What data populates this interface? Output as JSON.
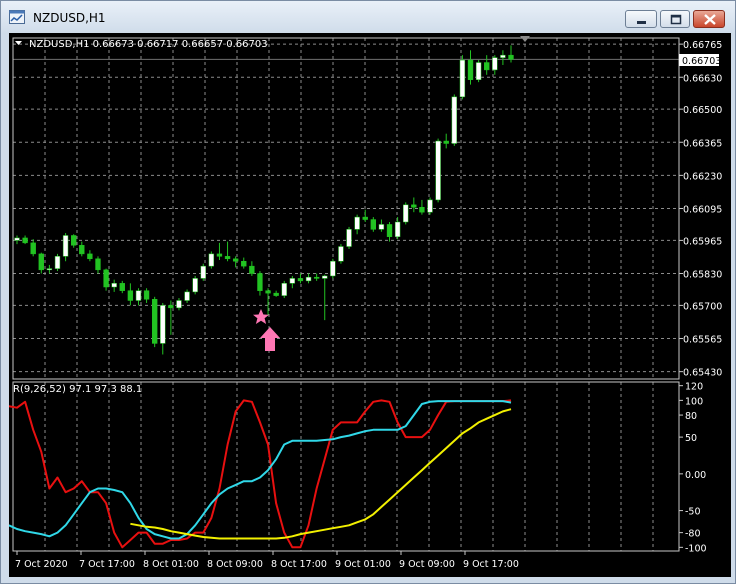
{
  "window": {
    "title": "NZDUSD,H1",
    "icons": {
      "app": "chart-window-icon",
      "minimize": "minimize-icon",
      "maximize": "maximize-icon",
      "close": "close-icon"
    }
  },
  "chart": {
    "header": "NZDUSD,H1  0.66673 0.66717 0.66657 0.66703",
    "current_price": "0.66703",
    "price_ticks": [
      "0.66765",
      "0.66630",
      "0.66500",
      "0.66365",
      "0.66230",
      "0.66095",
      "0.65965",
      "0.65830",
      "0.65700",
      "0.65565",
      "0.65430"
    ],
    "time_ticks": [
      "7 Oct 2020",
      "7 Oct 17:00",
      "8 Oct 01:00",
      "8 Oct 09:00",
      "8 Oct 17:00",
      "9 Oct 01:00",
      "9 Oct 09:00",
      "9 Oct 17:00"
    ],
    "indicator_header": "R(9,26,52) 97.1 97.3 88.1",
    "indicator_ticks": [
      "120",
      "100",
      "80",
      "50",
      "0.00",
      "-50",
      "-80",
      "-100"
    ],
    "colors": {
      "bull": "#ffffff",
      "bear": "#22c322",
      "wick": "#22c322",
      "grid": "#8c8c8c",
      "fast": "#e81010",
      "mid": "#30d8e8",
      "slow": "#f2f000",
      "marker": "#ff77b4"
    },
    "markers": {
      "star": "star-icon",
      "arrow": "up-arrow-icon"
    }
  },
  "chart_data": [
    {
      "type": "candlestick",
      "title": "NZDUSD,H1",
      "ylim": [
        0.654,
        0.6679
      ],
      "candles": [
        [
          0.65965,
          0.65985,
          0.6595,
          0.65975
        ],
        [
          0.65975,
          0.65985,
          0.6595,
          0.65955
        ],
        [
          0.65955,
          0.6597,
          0.659,
          0.6591
        ],
        [
          0.6591,
          0.65915,
          0.6583,
          0.65845
        ],
        [
          0.65845,
          0.65865,
          0.6583,
          0.6585
        ],
        [
          0.6585,
          0.6591,
          0.6584,
          0.659
        ],
        [
          0.659,
          0.65995,
          0.6588,
          0.65985
        ],
        [
          0.65985,
          0.6599,
          0.65935,
          0.65945
        ],
        [
          0.65945,
          0.6596,
          0.659,
          0.6591
        ],
        [
          0.6591,
          0.65925,
          0.6588,
          0.6589
        ],
        [
          0.6589,
          0.659,
          0.6583,
          0.65845
        ],
        [
          0.65845,
          0.6585,
          0.6576,
          0.65775
        ],
        [
          0.65775,
          0.65805,
          0.65755,
          0.6579
        ],
        [
          0.6579,
          0.658,
          0.6575,
          0.6576
        ],
        [
          0.6576,
          0.6579,
          0.657,
          0.6572
        ],
        [
          0.6572,
          0.6577,
          0.657,
          0.6576
        ],
        [
          0.6576,
          0.6577,
          0.6571,
          0.65725
        ],
        [
          0.65725,
          0.65735,
          0.6553,
          0.65545
        ],
        [
          0.65545,
          0.6571,
          0.655,
          0.657
        ],
        [
          0.657,
          0.6572,
          0.6558,
          0.6569
        ],
        [
          0.6569,
          0.6573,
          0.6568,
          0.6572
        ],
        [
          0.6572,
          0.65765,
          0.6571,
          0.65755
        ],
        [
          0.65755,
          0.6582,
          0.65745,
          0.6581
        ],
        [
          0.6581,
          0.6587,
          0.658,
          0.6586
        ],
        [
          0.6586,
          0.6592,
          0.6585,
          0.6591
        ],
        [
          0.6591,
          0.65955,
          0.65885,
          0.659
        ],
        [
          0.659,
          0.6596,
          0.6588,
          0.6589
        ],
        [
          0.6589,
          0.659,
          0.65855,
          0.6588
        ],
        [
          0.6588,
          0.65895,
          0.6585,
          0.6586
        ],
        [
          0.6586,
          0.6588,
          0.6582,
          0.6583
        ],
        [
          0.6583,
          0.6584,
          0.6574,
          0.6576
        ],
        [
          0.6576,
          0.6577,
          0.6566,
          0.6575
        ],
        [
          0.6575,
          0.6576,
          0.65735,
          0.6574
        ],
        [
          0.6574,
          0.658,
          0.6573,
          0.6579
        ],
        [
          0.6579,
          0.6582,
          0.6577,
          0.6581
        ],
        [
          0.6581,
          0.6583,
          0.6579,
          0.658
        ],
        [
          0.658,
          0.6583,
          0.6579,
          0.65815
        ],
        [
          0.65815,
          0.6583,
          0.658,
          0.6581
        ],
        [
          0.6581,
          0.65825,
          0.6564,
          0.6582
        ],
        [
          0.6582,
          0.6589,
          0.6581,
          0.6588
        ],
        [
          0.6588,
          0.6595,
          0.6587,
          0.6594
        ],
        [
          0.6594,
          0.6602,
          0.6593,
          0.6601
        ],
        [
          0.6601,
          0.6607,
          0.6599,
          0.6606
        ],
        [
          0.6606,
          0.6609,
          0.6604,
          0.6605
        ],
        [
          0.6605,
          0.6606,
          0.66,
          0.6601
        ],
        [
          0.6601,
          0.6605,
          0.66,
          0.6603
        ],
        [
          0.6603,
          0.6604,
          0.6596,
          0.6598
        ],
        [
          0.6598,
          0.6606,
          0.6597,
          0.6604
        ],
        [
          0.6604,
          0.6612,
          0.6603,
          0.6611
        ],
        [
          0.6611,
          0.6614,
          0.6608,
          0.661
        ],
        [
          0.661,
          0.6613,
          0.6607,
          0.6608
        ],
        [
          0.6608,
          0.6614,
          0.6607,
          0.6613
        ],
        [
          0.6613,
          0.6638,
          0.6612,
          0.6637
        ],
        [
          0.6637,
          0.664,
          0.6634,
          0.6636
        ],
        [
          0.6636,
          0.6656,
          0.6635,
          0.6655
        ],
        [
          0.6655,
          0.6672,
          0.6654,
          0.667
        ],
        [
          0.667,
          0.6674,
          0.666,
          0.6662
        ],
        [
          0.6662,
          0.667,
          0.6661,
          0.6669
        ],
        [
          0.6669,
          0.6672,
          0.6664,
          0.6666
        ],
        [
          0.6666,
          0.6672,
          0.6664,
          0.6671
        ],
        [
          0.6671,
          0.6674,
          0.6668,
          0.6672
        ],
        [
          0.6672,
          0.6676,
          0.6669,
          0.66703
        ]
      ]
    },
    {
      "type": "line",
      "title": "R(9,26,52) 97.1 97.3 88.1",
      "ylim": [
        -105,
        125
      ],
      "series": [
        {
          "color": "#e81010",
          "values": [
            92,
            90,
            98,
            60,
            30,
            -20,
            -5,
            -25,
            -20,
            -10,
            -25,
            -25,
            -40,
            -80,
            -100,
            -90,
            -80,
            -80,
            -95,
            -95,
            -90,
            -90,
            -88,
            -80,
            -80,
            -60,
            -20,
            40,
            85,
            100,
            98,
            70,
            40,
            -40,
            -80,
            -100,
            -100,
            -70,
            -20,
            20,
            60,
            70,
            70,
            70,
            85,
            98,
            100,
            98,
            70,
            50,
            50,
            50,
            60,
            80,
            98,
            99,
            99,
            99,
            99,
            99,
            99,
            99,
            100
          ]
        },
        {
          "color": "#30d8e8",
          "values": [
            -70,
            -75,
            -78,
            -80,
            -82,
            -85,
            -80,
            -70,
            -55,
            -40,
            -25,
            -20,
            -20,
            -22,
            -25,
            -40,
            -60,
            -75,
            -82,
            -85,
            -88,
            -88,
            -82,
            -70,
            -55,
            -40,
            -28,
            -20,
            -15,
            -10,
            -10,
            -5,
            5,
            20,
            40,
            45,
            45,
            45,
            45,
            46,
            47,
            50,
            52,
            55,
            58,
            60,
            60,
            60,
            60,
            65,
            80,
            95,
            98,
            99,
            99,
            99,
            99,
            99,
            99,
            99,
            99,
            99,
            97
          ]
        },
        {
          "color": "#f2f000",
          "values": [
            -68,
            -70,
            -72,
            -73,
            -75,
            -78,
            -80,
            -82,
            -84,
            -86,
            -87,
            -88,
            -88,
            -88,
            -88,
            -88,
            -88,
            -88,
            -88,
            -87,
            -85,
            -82,
            -80,
            -78,
            -76,
            -74,
            -72,
            -70,
            -66,
            -62,
            -55,
            -45,
            -35,
            -25,
            -15,
            -5,
            5,
            15,
            25,
            35,
            45,
            55,
            62,
            70,
            75,
            80,
            85,
            88
          ]
        }
      ]
    }
  ]
}
